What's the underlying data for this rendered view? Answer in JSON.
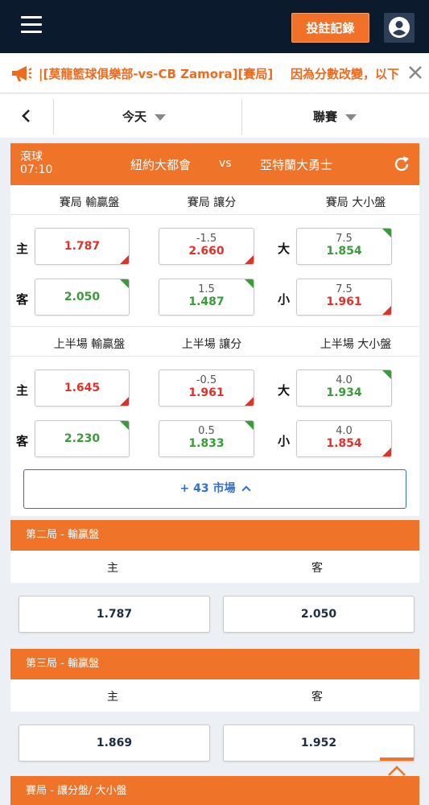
{
  "header": {
    "record_label": "投註記錄",
    "accent": "#f07127"
  },
  "notice": {
    "left_text": "|[莫龍籃球俱樂部-vs-CB Zamora][賽局]",
    "right_text": "因為分數改變，以下"
  },
  "filter": {
    "date_label": "今天",
    "league_label": "聯賽"
  },
  "match": {
    "status": "滾球",
    "time": "07:10",
    "home": "紐約大都會",
    "vs": "vs",
    "away": "亞特蘭大勇士"
  },
  "full_game": {
    "moneyline_title": "賽局 輸贏盤",
    "handicap_title": "賽局 讓分",
    "total_title": "賽局 大小盤",
    "home_label": "主",
    "away_label": "客",
    "over_label": "大",
    "under_label": "小",
    "home_ml": "1.787",
    "away_ml": "2.050",
    "home_hcp_line": "-1.5",
    "home_hcp_price": "2.660",
    "away_hcp_line": "1.5",
    "away_hcp_price": "1.487",
    "over_line": "7.5",
    "over_price": "1.854",
    "under_line": "7.5",
    "under_price": "1.961"
  },
  "first_half": {
    "moneyline_title": "上半場 輸贏盤",
    "handicap_title": "上半場 讓分",
    "total_title": "上半場 大小盤",
    "home_label": "主",
    "away_label": "客",
    "over_label": "大",
    "under_label": "小",
    "home_ml": "1.645",
    "away_ml": "2.230",
    "home_hcp_line": "-0.5",
    "home_hcp_price": "1.961",
    "away_hcp_line": "0.5",
    "away_hcp_price": "1.833",
    "over_line": "4.0",
    "over_price": "1.934",
    "under_line": "4.0",
    "under_price": "1.854"
  },
  "more_markets": "+ 43 市場",
  "inning2": {
    "title": "第二局 - 輸贏盤",
    "home_label": "主",
    "away_label": "客",
    "home_price": "1.787",
    "away_price": "2.050"
  },
  "inning3": {
    "title": "第三局 - 輸贏盤",
    "home_label": "主",
    "away_label": "客",
    "home_price": "1.869",
    "away_price": "1.952"
  },
  "next_section": {
    "title": "賽局 - 讓分盤/ 大小盤"
  }
}
